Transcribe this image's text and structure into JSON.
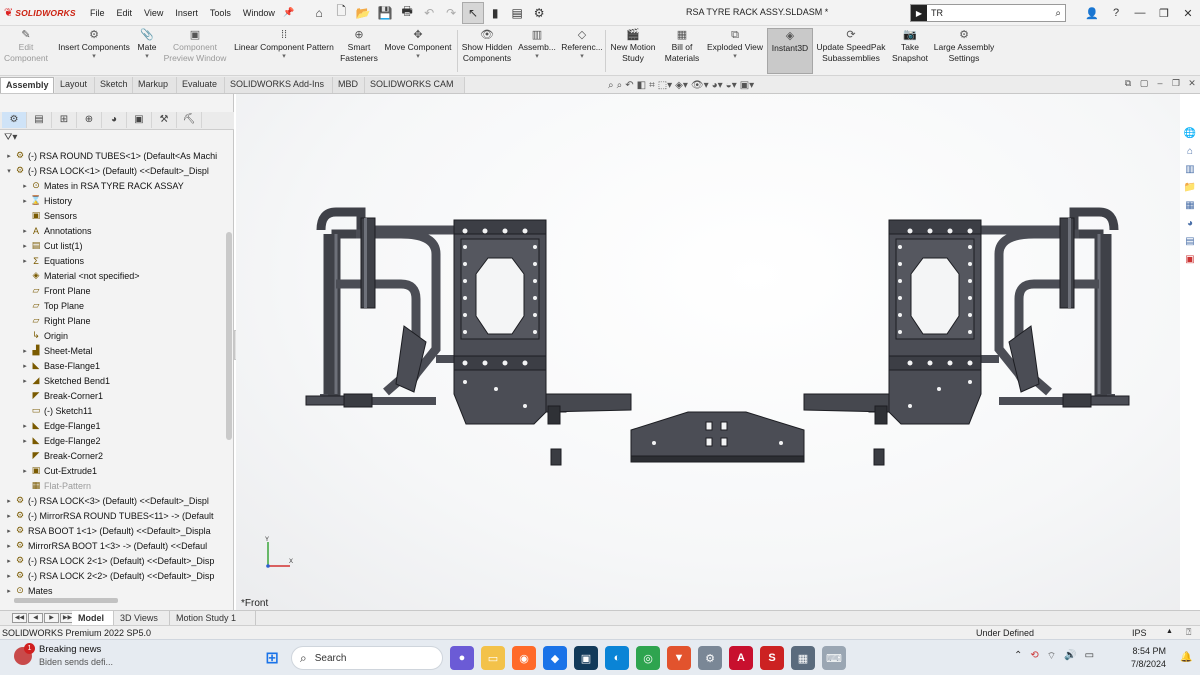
{
  "app": {
    "logo_text": "SOLIDWORKS",
    "menus": [
      "File",
      "Edit",
      "View",
      "Insert",
      "Tools",
      "Window"
    ],
    "document_title": "RSA TYRE RACK ASSY.SLDASM *",
    "search_query": "TR"
  },
  "commands": [
    {
      "label": "Edit\nComponent",
      "icon": "edit-component-icon",
      "disabled": true
    },
    {
      "label": "Insert Components",
      "icon": "insert-components-icon",
      "disabled": false
    },
    {
      "label": "Mate",
      "icon": "mate-icon",
      "disabled": false
    },
    {
      "label": "Component\nPreview Window",
      "icon": "preview-window-icon",
      "disabled": true
    },
    {
      "label": "Linear Component Pattern",
      "icon": "linear-pattern-icon",
      "disabled": false
    },
    {
      "label": "Smart\nFasteners",
      "icon": "smart-fasteners-icon",
      "disabled": false
    },
    {
      "label": "Move Component",
      "icon": "move-component-icon",
      "disabled": false
    },
    {
      "label": "Show Hidden\nComponents",
      "icon": "show-hidden-icon",
      "disabled": false
    },
    {
      "label": "Assemb...",
      "icon": "assembly-features-icon",
      "disabled": false
    },
    {
      "label": "Referenc...",
      "icon": "reference-geometry-icon",
      "disabled": false
    },
    {
      "label": "New Motion\nStudy",
      "icon": "motion-study-icon",
      "disabled": false
    },
    {
      "label": "Bill of\nMaterials",
      "icon": "bom-icon",
      "disabled": false
    },
    {
      "label": "Exploded View",
      "icon": "exploded-view-icon",
      "disabled": false
    },
    {
      "label": "Instant3D",
      "icon": "instant3d-icon",
      "disabled": false,
      "active": true
    },
    {
      "label": "Update SpeedPak\nSubassemblies",
      "icon": "speedpak-icon",
      "disabled": false
    },
    {
      "label": "Take\nSnapshot",
      "icon": "snapshot-icon",
      "disabled": false
    },
    {
      "label": "Large Assembly\nSettings",
      "icon": "large-assembly-icon",
      "disabled": false
    }
  ],
  "tabs": [
    "Assembly",
    "Layout",
    "Sketch",
    "Markup",
    "Evaluate",
    "SOLIDWORKS Add-Ins",
    "MBD",
    "SOLIDWORKS CAM"
  ],
  "active_tab": "Assembly",
  "tree": [
    {
      "label": "(-) RSA ROUND TUBES<1> (Default<As Machi",
      "level": 0,
      "expand": "▸",
      "icon": "part-icon"
    },
    {
      "label": "(-) RSA LOCK<1> (Default) <<Default>_Displ",
      "level": 0,
      "expand": "▾",
      "icon": "part-icon"
    },
    {
      "label": "Mates in RSA TYRE RACK ASSAY",
      "level": 1,
      "expand": "▸",
      "icon": "mates-icon"
    },
    {
      "label": "History",
      "level": 1,
      "expand": "▸",
      "icon": "history-icon"
    },
    {
      "label": "Sensors",
      "level": 1,
      "expand": "",
      "icon": "sensors-icon"
    },
    {
      "label": "Annotations",
      "level": 1,
      "expand": "▸",
      "icon": "annotations-icon"
    },
    {
      "label": "Cut list(1)",
      "level": 1,
      "expand": "▸",
      "icon": "cut-list-icon"
    },
    {
      "label": "Equations",
      "level": 1,
      "expand": "▸",
      "icon": "equations-icon"
    },
    {
      "label": "Material <not specified>",
      "level": 1,
      "expand": "",
      "icon": "material-icon"
    },
    {
      "label": "Front Plane",
      "level": 1,
      "expand": "",
      "icon": "plane-icon"
    },
    {
      "label": "Top Plane",
      "level": 1,
      "expand": "",
      "icon": "plane-icon"
    },
    {
      "label": "Right Plane",
      "level": 1,
      "expand": "",
      "icon": "plane-icon"
    },
    {
      "label": "Origin",
      "level": 1,
      "expand": "",
      "icon": "origin-icon"
    },
    {
      "label": "Sheet-Metal",
      "level": 1,
      "expand": "▸",
      "icon": "sheet-metal-icon"
    },
    {
      "label": "Base-Flange1",
      "level": 1,
      "expand": "▸",
      "icon": "flange-icon"
    },
    {
      "label": "Sketched Bend1",
      "level": 1,
      "expand": "▸",
      "icon": "bend-icon"
    },
    {
      "label": "Break-Corner1",
      "level": 1,
      "expand": "",
      "icon": "corner-icon"
    },
    {
      "label": "(-) Sketch11",
      "level": 1,
      "expand": "",
      "icon": "sketch-icon"
    },
    {
      "label": "Edge-Flange1",
      "level": 1,
      "expand": "▸",
      "icon": "flange-icon"
    },
    {
      "label": "Edge-Flange2",
      "level": 1,
      "expand": "▸",
      "icon": "flange-icon"
    },
    {
      "label": "Break-Corner2",
      "level": 1,
      "expand": "",
      "icon": "corner-icon"
    },
    {
      "label": "Cut-Extrude1",
      "level": 1,
      "expand": "▸",
      "icon": "extrude-icon"
    },
    {
      "label": "Flat-Pattern",
      "level": 1,
      "expand": "",
      "icon": "flat-pattern-icon",
      "grey": true
    },
    {
      "label": "(-) RSA LOCK<3> (Default) <<Default>_Displ",
      "level": 0,
      "expand": "▸",
      "icon": "part-icon"
    },
    {
      "label": "(-) MirrorRSA ROUND TUBES<11> -> (Default",
      "level": 0,
      "expand": "▸",
      "icon": "part-icon"
    },
    {
      "label": "RSA BOOT 1<1> (Default) <<Default>_Displa",
      "level": 0,
      "expand": "▸",
      "icon": "part-icon"
    },
    {
      "label": "MirrorRSA BOOT 1<3> -> (Default) <<Defaul",
      "level": 0,
      "expand": "▸",
      "icon": "part-icon"
    },
    {
      "label": "(-) RSA LOCK 2<1> (Default) <<Default>_Disp",
      "level": 0,
      "expand": "▸",
      "icon": "part-icon"
    },
    {
      "label": "(-) RSA LOCK 2<2> (Default) <<Default>_Disp",
      "level": 0,
      "expand": "▸",
      "icon": "part-icon"
    },
    {
      "label": "Mates",
      "level": 0,
      "expand": "▸",
      "icon": "mates-icon"
    }
  ],
  "viewport": {
    "view_label": "*Front"
  },
  "bottom_tabs": [
    "Model",
    "3D Views",
    "Motion Study 1"
  ],
  "active_bottom_tab": "Model",
  "status": {
    "left": "SOLIDWORKS Premium 2022 SP5.0",
    "middle": "Under Defined",
    "units": "IPS"
  },
  "taskbar": {
    "news_title": "Breaking news",
    "news_sub": "Biden sends defi...",
    "news_badge": "1",
    "search_placeholder": "Search",
    "time": "8:54 PM",
    "date": "7/8/2024"
  },
  "colors": {
    "accent": "#4a6fa8",
    "model_fill": "#4b4d55",
    "model_edge": "#1c1d22",
    "logo_red": "#cc2222"
  }
}
